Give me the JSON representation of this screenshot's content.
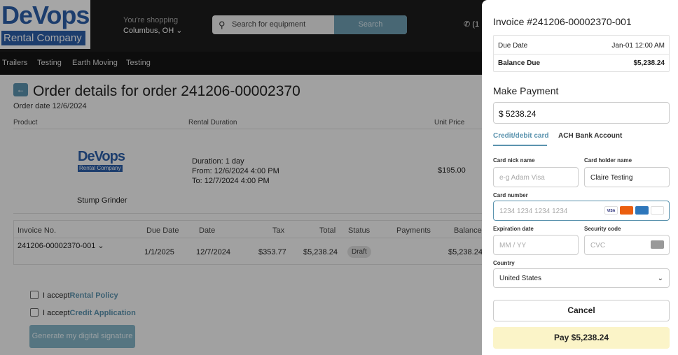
{
  "header": {
    "logo_top": "DeVops",
    "logo_bottom": "Rental Company",
    "shopping_label": "You're shopping",
    "location": "Columbus, OH",
    "search_placeholder": "Search for equipment",
    "search_button": "Search",
    "phone": "(1"
  },
  "nav": [
    "Trailers",
    "Testing",
    "Earth Moving",
    "Testing"
  ],
  "order": {
    "title": "Order details for order 241206-00002370",
    "order_date": "Order date 12/6/2024",
    "col_product": "Product",
    "col_duration": "Rental Duration",
    "col_unit_price": "Unit Price",
    "product_logo_top": "DeVops",
    "product_logo_bottom": "Rental Company",
    "product_name": "Stump Grinder",
    "duration": "Duration: 1 day",
    "from": "From: 12/6/2024 4:00 PM",
    "to": "To: 12/7/2024 4:00 PM",
    "unit_price": "$195.00"
  },
  "invoice_table": {
    "headers": [
      "Invoice No.",
      "Due Date",
      "Date",
      "Tax",
      "Total",
      "Status",
      "Payments",
      "Balance"
    ],
    "row": {
      "invoice_no": "241206-00002370-001",
      "due_date": "1/1/2025",
      "date": "12/7/2024",
      "tax": "$353.77",
      "total": "$5,238.24",
      "status": "Draft",
      "payments": "",
      "balance": "$5,238.24"
    }
  },
  "agreements": {
    "prefix": "I accept",
    "rental_policy": "Rental Policy",
    "credit_application": "Credit Application",
    "signature_button": "Generate my digital signature"
  },
  "panel": {
    "title": "Invoice #241206-00002370-001",
    "due_date_label": "Due Date",
    "due_date_value": "Jan-01 12:00 AM",
    "balance_label": "Balance Due",
    "balance_value": "$5,238.24",
    "make_payment": "Make Payment",
    "amount": "$  5238.24",
    "tab_card": "Credit/debit card",
    "tab_ach": "ACH Bank Account",
    "card_nick_label": "Card nick name",
    "card_nick_placeholder": "e-g Adam Visa",
    "holder_label": "Card holder name",
    "holder_value": "Claire Testing",
    "card_number_label": "Card number",
    "card_number_placeholder": "1234 1234 1234 1234",
    "exp_label": "Expiration date",
    "exp_placeholder": "MM / YY",
    "cvc_label": "Security code",
    "cvc_placeholder": "CVC",
    "country_label": "Country",
    "country_value": "United States",
    "cancel": "Cancel",
    "pay": "Pay $5,238.24",
    "card_brands": [
      "VISA",
      "MC",
      "AMEX",
      "DISCOVER"
    ]
  },
  "colors": {
    "accent": "#5b93ae",
    "pay_bg": "#fbf4c8",
    "header_bg": "#1c1c1c"
  }
}
